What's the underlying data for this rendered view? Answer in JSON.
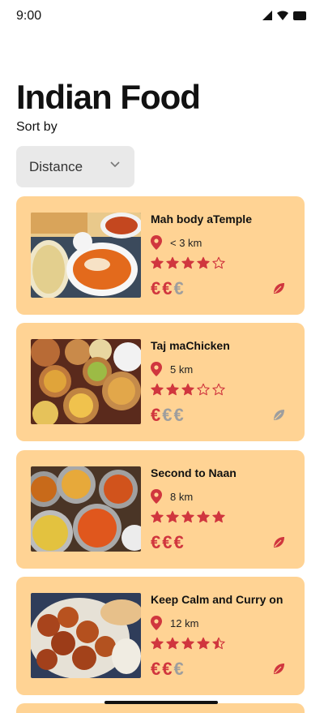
{
  "status": {
    "time": "9:00"
  },
  "header": {
    "title": "Indian Food",
    "sort_label": "Sort by"
  },
  "sort": {
    "selected": "Distance"
  },
  "colors": {
    "card": "#ffd394",
    "accent": "#d0363e",
    "inactive": "#9e9e9e"
  },
  "restaurants": [
    {
      "name": "Mah body aTemple",
      "distance": "< 3 km",
      "rating": 4,
      "price": 2,
      "vegetarian": true
    },
    {
      "name": "Taj maChicken",
      "distance": "5 km",
      "rating": 3,
      "price": 1,
      "vegetarian": false
    },
    {
      "name": "Second to Naan",
      "distance": "8 km",
      "rating": 5,
      "price": 3,
      "vegetarian": true
    },
    {
      "name": "Keep Calm and Curry on",
      "distance": "12 km",
      "rating": 4.5,
      "price": 2,
      "vegetarian": true
    }
  ]
}
